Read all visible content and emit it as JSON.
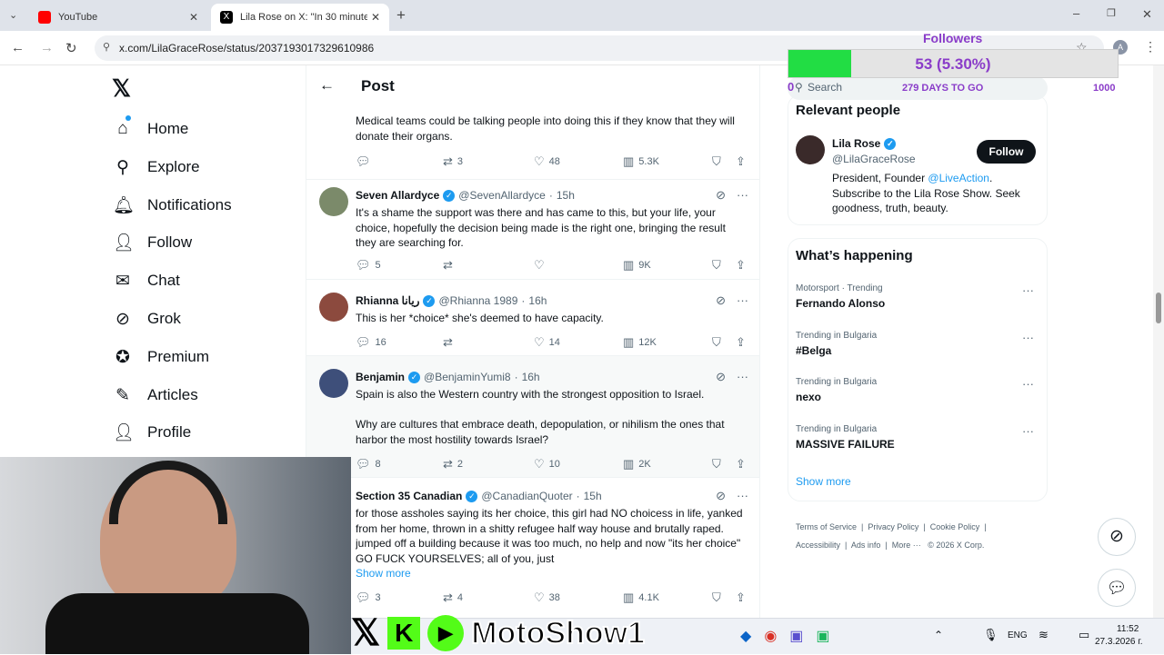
{
  "browser": {
    "tabs": [
      {
        "title": "YouTube"
      },
      {
        "title": "Lila Rose on X: \"In 30 minutes, S"
      }
    ],
    "url": "x.com/LilaGraceRose/status/2037193017329610986",
    "new_tab": "+"
  },
  "nav": {
    "items": [
      {
        "label": "Home",
        "icon": "home-icon"
      },
      {
        "label": "Explore",
        "icon": "search-icon"
      },
      {
        "label": "Notifications",
        "icon": "bell-icon"
      },
      {
        "label": "Follow",
        "icon": "person-add-icon"
      },
      {
        "label": "Chat",
        "icon": "mail-icon"
      },
      {
        "label": "Grok",
        "icon": "grok-icon"
      },
      {
        "label": "Premium",
        "icon": "verified-icon"
      },
      {
        "label": "Articles",
        "icon": "article-icon"
      },
      {
        "label": "Profile",
        "icon": "person-icon"
      }
    ]
  },
  "header": {
    "title": "Post"
  },
  "replies": [
    {
      "text": "Medical teams could be talking people into doing this if they know that they will donate their organs.",
      "replies": "",
      "reposts": "3",
      "likes": "48",
      "views": "5.3K"
    },
    {
      "name": "Seven Allardyce",
      "handle": "@SevenAllardyce",
      "time": "15h",
      "text": "It's a shame the support was there and has came to this, but your life, your choice, hopefully the decision being made is the right one, bringing the result they are searching for.",
      "replies": "5",
      "reposts": "",
      "likes": "",
      "views": "9K"
    },
    {
      "name": "Rhianna ريانا",
      "handle": "@Rhianna 1989",
      "time": "16h",
      "text": "This is her *choice* she's deemed to have capacity.",
      "replies": "16",
      "reposts": "",
      "likes": "14",
      "views": "12K"
    },
    {
      "name": "Benjamin",
      "handle": "@BenjaminYumi8",
      "time": "16h",
      "text": "Spain is also the Western country with the strongest opposition to Israel.",
      "text2": "Why are cultures that embrace death, depopulation, or nihilism the ones that harbor the most hostility towards Israel?",
      "replies": "8",
      "reposts": "2",
      "likes": "10",
      "views": "2K"
    },
    {
      "name": "Section 35 Canadian",
      "handle": "@CanadianQuoter",
      "time": "15h",
      "text": "for those assholes saying its her choice, this girl had NO choicess in life, yanked from her home, thrown in a shitty refugee half way house and brutally raped. jumped off a building because it was too much, no help and now \"its her choice\" GO FUCK YOURSELVES; all of you, just",
      "show_more": "Show more",
      "replies": "3",
      "reposts": "4",
      "likes": "38",
      "views": "4.1K"
    }
  ],
  "right": {
    "search_placeholder": "Search",
    "relevant_title": "Relevant people",
    "person": {
      "name": "Lila Rose",
      "handle": "@LilaGraceRose",
      "follow_label": "Follow",
      "bio_pre": "President, Founder ",
      "bio_link": "@LiveAction",
      "bio_post": ". Subscribe to the Lila Rose Show. Seek goodness, truth, beauty."
    },
    "happening_title": "What’s happening",
    "trends": [
      {
        "category": "Motorsport · Trending",
        "title": "Fernando Alonso"
      },
      {
        "category": "Trending in Bulgaria",
        "title": "#Belga"
      },
      {
        "category": "Trending in Bulgaria",
        "title": "nexo"
      },
      {
        "category": "Trending in Bulgaria",
        "title": "MASSIVE FAILURE"
      }
    ],
    "show_more": "Show more",
    "footer": [
      "Terms of Service",
      "Privacy Policy",
      "Cookie Policy",
      "Accessibility",
      "Ads info",
      "More ···",
      "© 2026 X Corp."
    ]
  },
  "overlay": {
    "title": "Followers",
    "progress_text": "53 (5.30%)",
    "progress_fraction": 0.053,
    "min": "0",
    "max": "1000",
    "days": "279 DAYS TO GO",
    "brand": "MotoShow1"
  },
  "taskbar": {
    "lang": "ENG",
    "time": "11:52",
    "date": "27.3.2026 г."
  },
  "colors": {
    "accent": "#1d9bf0",
    "progress": "#22dd44",
    "overlay_text": "#8a3cc9"
  }
}
